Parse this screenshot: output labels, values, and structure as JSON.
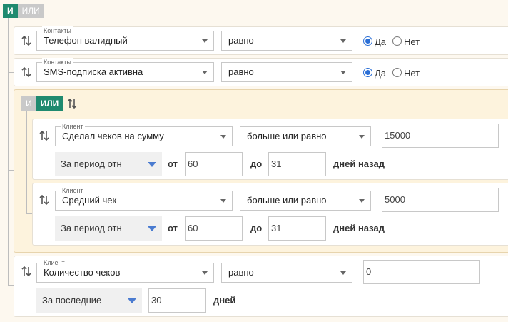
{
  "root_toggle": {
    "and": "И",
    "or": "ИЛИ",
    "active": "and"
  },
  "rows": {
    "phone": {
      "group_label": "Контакты",
      "field": "Телефон валидный",
      "operator": "равно",
      "yes": "Да",
      "no": "Нет",
      "selected": "yes"
    },
    "sms": {
      "group_label": "Контакты",
      "field": "SMS-подписка активна",
      "operator": "равно",
      "yes": "Да",
      "no": "Нет",
      "selected": "yes"
    }
  },
  "group": {
    "toggle": {
      "and": "И",
      "or": "ИЛИ",
      "active": "or"
    },
    "rows": {
      "sum": {
        "group_label": "Клиент",
        "field": "Сделал чеков на сумму",
        "operator": "больше или равно",
        "value": "15000",
        "period": "За период отн",
        "from_label": "от",
        "from_value": "60",
        "to_label": "до",
        "to_value": "31",
        "suffix": "дней назад"
      },
      "avg": {
        "group_label": "Клиент",
        "field": "Средний чек",
        "operator": "больше или равно",
        "value": "5000",
        "period": "За период отн",
        "from_label": "от",
        "from_value": "60",
        "to_label": "до",
        "to_value": "31",
        "suffix": "дней назад"
      }
    }
  },
  "count_row": {
    "group_label": "Клиент",
    "field": "Количество чеков",
    "operator": "равно",
    "value": "0",
    "period": "За последние",
    "days_value": "30",
    "suffix": "дней"
  },
  "colors": {
    "toggle_active": "#1f8a6f",
    "toggle_inactive": "#c9c9c9",
    "radio_selected": "#2b6fd6",
    "period_caret": "#4a7bd0",
    "group_bg": "#fdf3dd"
  },
  "icons": {
    "sort": "sort-arrows-icon",
    "dropdown": "chevron-down-icon"
  }
}
